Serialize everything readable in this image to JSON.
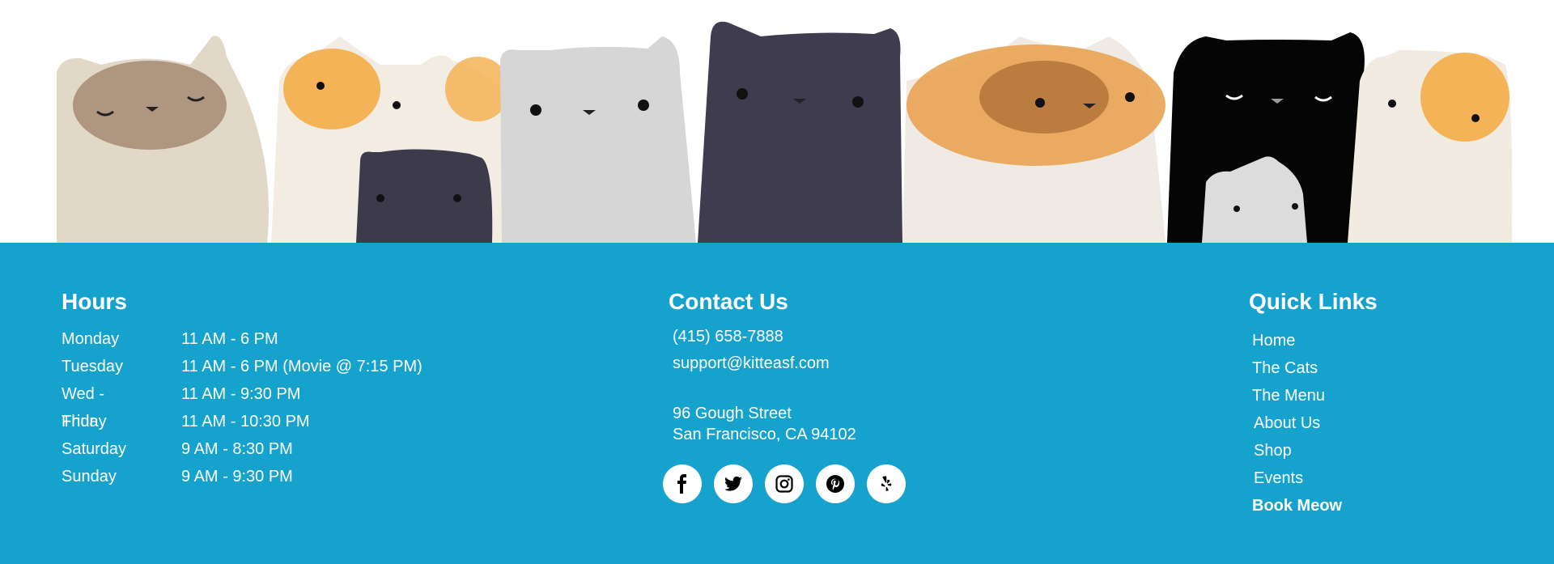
{
  "colors": {
    "footer_bg": "#15a2cd",
    "text": "#ffffff"
  },
  "banner": {
    "illustration": "row of cartoon cats"
  },
  "hours": {
    "title": "Hours",
    "rows": [
      {
        "day": "Monday",
        "time": "11 AM - 6 PM"
      },
      {
        "day": "Tuesday",
        "time": "11 AM - 6 PM (Movie @ 7:15 PM)"
      },
      {
        "day": "Wed - Thur",
        "time": "11 AM - 9:30 PM"
      },
      {
        "day": "Friday",
        "time": "11 AM - 10:30 PM"
      },
      {
        "day": "Saturday",
        "time": " 9 AM - 8:30 PM"
      },
      {
        "day": "Sunday",
        "time": " 9 AM - 9:30 PM"
      }
    ]
  },
  "contact": {
    "title": "Contact Us",
    "phone": "(415) 658-7888",
    "email": "support@kitteasf.com",
    "address_line1": "96 Gough Street",
    "address_line2": "San Francisco, CA 94102",
    "social": [
      "facebook-icon",
      "twitter-icon",
      "instagram-icon",
      "pinterest-icon",
      "yelp-icon"
    ]
  },
  "quick_links": {
    "title": "Quick Links",
    "items": [
      "Home",
      "The Cats",
      "The Menu",
      "About Us",
      "Shop",
      "Events",
      "Book Meow"
    ]
  }
}
